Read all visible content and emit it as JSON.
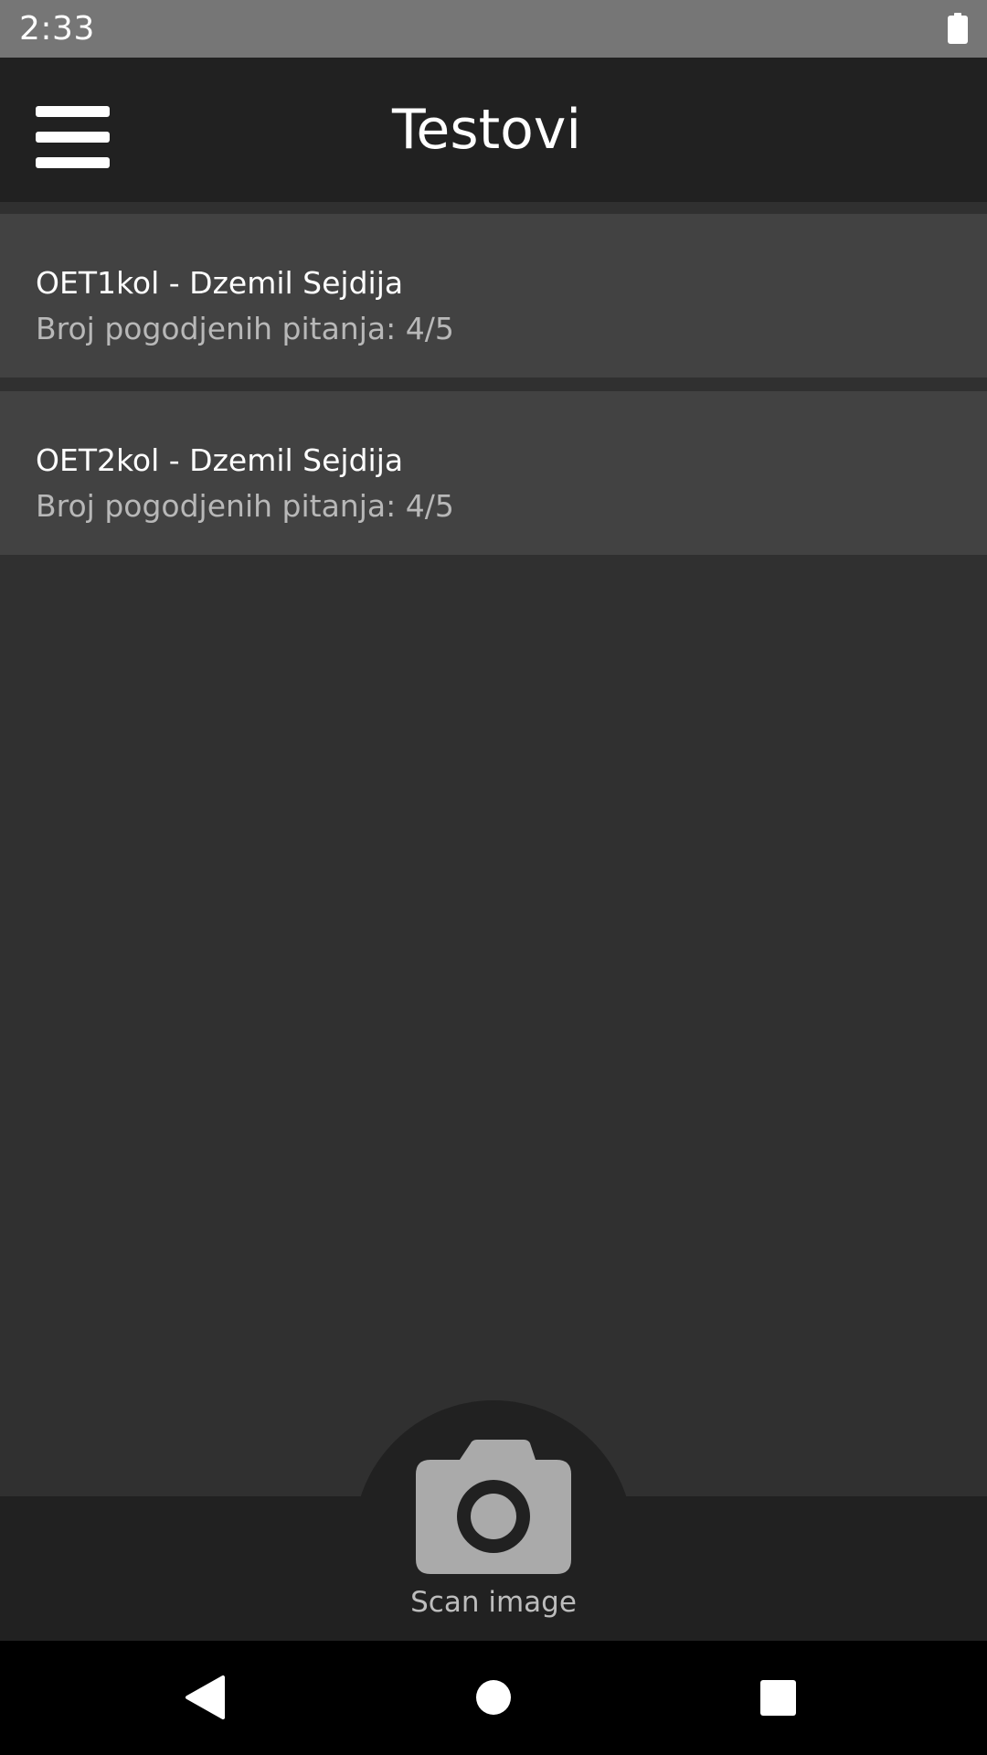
{
  "status_bar": {
    "time": "2:33",
    "battery_icon": "battery-full-icon"
  },
  "toolbar": {
    "title": "Testovi",
    "menu_icon": "hamburger-menu-icon"
  },
  "tests": [
    {
      "title": "OET1kol - Dzemil Sejdija",
      "subtitle": "Broj pogodjenih pitanja: 4/5"
    },
    {
      "title": "OET2kol - Dzemil Sejdija",
      "subtitle": "Broj pogodjenih pitanja: 4/5"
    }
  ],
  "scan": {
    "icon": "camera-icon",
    "label": "Scan image"
  },
  "nav": {
    "back_icon": "back-triangle-icon",
    "home_icon": "home-circle-icon",
    "recents_icon": "recents-square-icon"
  },
  "colors": {
    "status_bar": "#767676",
    "toolbar": "#212121",
    "background": "#303030",
    "list_item": "#424242",
    "camera_icon": "#aaaaaa"
  }
}
